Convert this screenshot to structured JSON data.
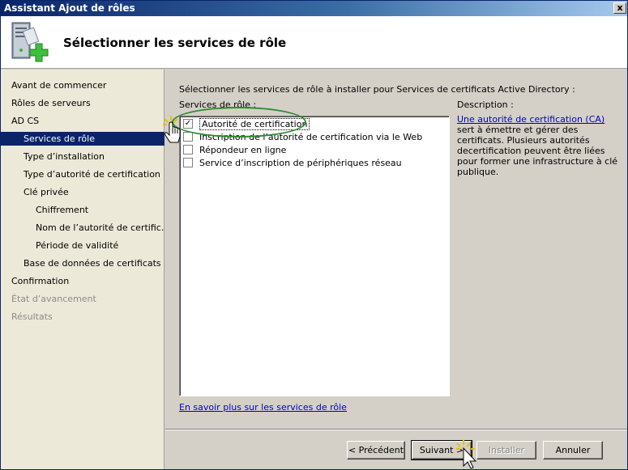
{
  "window": {
    "title": "Assistant Ajout de rôles",
    "close_glyph": "x"
  },
  "header": {
    "title": "Sélectionner les services de rôle",
    "icon": "server-add-icon"
  },
  "nav": {
    "items": [
      {
        "label": "Avant de commencer",
        "indent": 0,
        "state": "normal"
      },
      {
        "label": "Rôles de serveurs",
        "indent": 0,
        "state": "normal"
      },
      {
        "label": "AD CS",
        "indent": 0,
        "state": "normal"
      },
      {
        "label": "Services de rôle",
        "indent": 1,
        "state": "selected"
      },
      {
        "label": "Type d’installation",
        "indent": 1,
        "state": "normal"
      },
      {
        "label": "Type d’autorité de certification",
        "indent": 1,
        "state": "normal"
      },
      {
        "label": "Clé privée",
        "indent": 1,
        "state": "normal"
      },
      {
        "label": "Chiffrement",
        "indent": 2,
        "state": "normal"
      },
      {
        "label": "Nom de l’autorité de certific…",
        "indent": 2,
        "state": "normal"
      },
      {
        "label": "Période de validité",
        "indent": 2,
        "state": "normal"
      },
      {
        "label": "Base de données de certificats",
        "indent": 1,
        "state": "normal"
      },
      {
        "label": "Confirmation",
        "indent": 0,
        "state": "normal"
      },
      {
        "label": "État d’avancement",
        "indent": 0,
        "state": "disabled"
      },
      {
        "label": "Résultats",
        "indent": 0,
        "state": "disabled"
      }
    ]
  },
  "content": {
    "instruction": "Sélectionner les services de rôle à installer pour Services de certificats Active Directory :",
    "services_label": "Services de rôle :",
    "services": [
      {
        "label": "Autorité de certification",
        "checked": true
      },
      {
        "label": "Inscription de l’autorité de certification via le Web",
        "checked": false
      },
      {
        "label": "Répondeur en ligne",
        "checked": false
      },
      {
        "label": "Service d’inscription de périphériques réseau",
        "checked": false
      }
    ],
    "description_label": "Description :",
    "description_link": "Une autorité de certification (CA)",
    "description_text": " sert à émettre et gérer des certificats. Plusieurs autorités decertification peuvent être liées pour former une infrastructure à clé publique.",
    "more_link": "En savoir plus sur les services de rôle"
  },
  "buttons": {
    "previous": "< Précédent",
    "next": "Suivant >",
    "install": "Installer",
    "cancel": "Annuler"
  },
  "colors": {
    "selection": "#0a246a",
    "annotation_oval": "#2e8b2e",
    "link": "#0000cc"
  }
}
